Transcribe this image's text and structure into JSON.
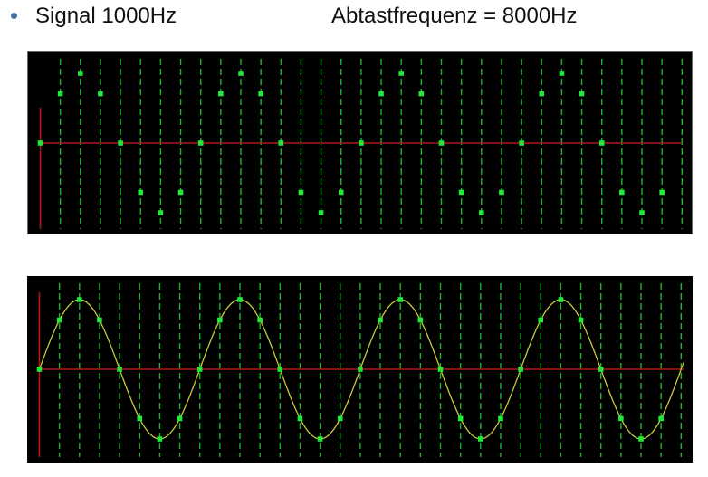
{
  "header": {
    "signal_text": "Signal 1000Hz",
    "sampling_text": "Abtastfrequenz = 8000Hz"
  },
  "colors": {
    "background": "#000000",
    "axis": "#b01818",
    "sample_lines": "#19b82a",
    "sample_points": "#22e83c",
    "reconstructed_wave": "#c9c93a",
    "bullet": "#3f6fa3"
  },
  "chart_data": [
    {
      "type": "scatter",
      "title": "",
      "signal_frequency_hz": 1000,
      "sampling_frequency_hz": 8000,
      "xlabel": "",
      "ylabel": "",
      "x": [
        0,
        1,
        2,
        3,
        4,
        5,
        6,
        7,
        8,
        9,
        10,
        11,
        12,
        13,
        14,
        15,
        16,
        17,
        18,
        19,
        20,
        21,
        22,
        23,
        24,
        25,
        26,
        27,
        28,
        29,
        30,
        31,
        32
      ],
      "values": [
        0,
        0.707,
        1,
        0.707,
        0,
        -0.707,
        -1,
        -0.707,
        0,
        0.707,
        1,
        0.707,
        0,
        -0.707,
        -1,
        -0.707,
        0,
        0.707,
        1,
        0.707,
        0,
        -0.707,
        -1,
        -0.707,
        0,
        0.707,
        1,
        0.707,
        0,
        -0.707,
        -1,
        -0.707,
        null
      ],
      "ylim": [
        -1,
        1
      ],
      "grid": "vertical dashed lines at every sample"
    },
    {
      "type": "line",
      "title": "",
      "xlabel": "",
      "ylabel": "",
      "x": [
        0,
        1,
        2,
        3,
        4,
        5,
        6,
        7,
        8,
        9,
        10,
        11,
        12,
        13,
        14,
        15,
        16,
        17,
        18,
        19,
        20,
        21,
        22,
        23,
        24,
        25,
        26,
        27,
        28,
        29,
        30,
        31,
        32
      ],
      "values": [
        0,
        0.707,
        1,
        0.707,
        0,
        -0.707,
        -1,
        -0.707,
        0,
        0.707,
        1,
        0.707,
        0,
        -0.707,
        -1,
        -0.707,
        0,
        0.707,
        1,
        0.707,
        0,
        -0.707,
        -1,
        -0.707,
        0,
        0.707,
        1,
        0.707,
        0,
        -0.707,
        -1,
        -0.707,
        null
      ],
      "series": [
        {
          "style": "sample points",
          "values": "sampled"
        },
        {
          "style": "continuous sine curve",
          "cycles": 4
        }
      ],
      "ylim": [
        -1,
        1
      ],
      "grid": "vertical dashed lines at every sample"
    }
  ]
}
